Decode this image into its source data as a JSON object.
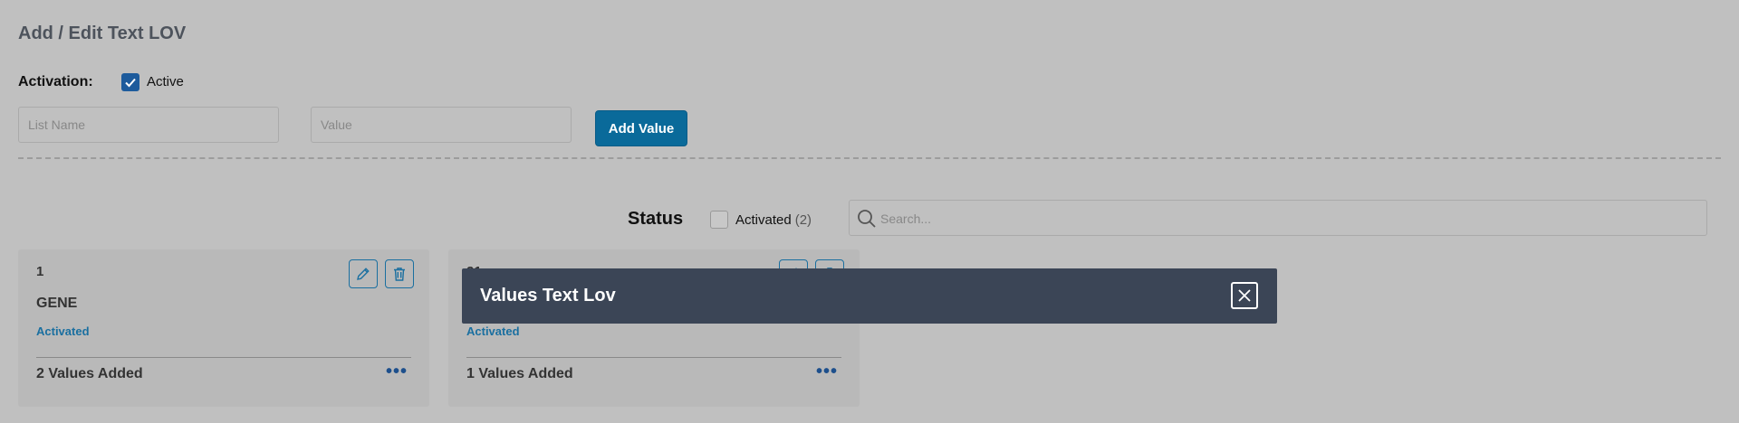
{
  "page": {
    "title": "Add / Edit Text LOV"
  },
  "activation": {
    "label": "Activation:",
    "checkbox_label": "Active",
    "checked": true
  },
  "form": {
    "list_name_placeholder": "List Name",
    "value_placeholder": "Value",
    "add_value_label": "Add Value"
  },
  "filters": {
    "status_label": "Status",
    "activated_label": "Activated",
    "activated_count": "(2)",
    "search_placeholder": "Search..."
  },
  "cards": [
    {
      "number": "1",
      "name": "GENE",
      "status": "Activated",
      "values_added": "2 Values Added"
    },
    {
      "number": "21",
      "name": "",
      "status": "Activated",
      "values_added": "1 Values Added"
    }
  ],
  "modal": {
    "title": "Values Text Lov"
  },
  "colors": {
    "primary": "#0a6a9a",
    "modal_header": "#3b4556",
    "accent_text": "#1a6fa0",
    "overlay_background": "#c0c0c0"
  },
  "icons": {
    "checkbox": "check-icon",
    "search": "search-icon",
    "edit": "pencil-icon",
    "delete": "trash-icon",
    "more": "more-dots-icon",
    "close": "close-icon"
  }
}
